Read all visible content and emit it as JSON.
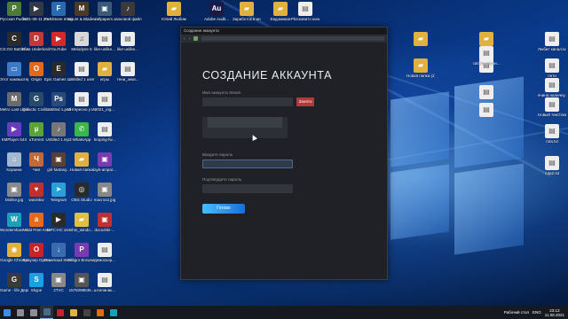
{
  "desktop": {
    "col1": [
      {
        "label": "Русская Рыбалка 4",
        "color": "#4d7a3a",
        "glyph": "Р"
      },
      {
        "label": "CS:GO Battlefield 1",
        "color": "#2b2b2b",
        "glyph": "C"
      },
      {
        "label": "Этот компьютер",
        "color": "#3c79c7",
        "glyph": "▭"
      },
      {
        "label": "Metro Last Light Redux",
        "color": "#6b6b6b",
        "glyph": "M"
      },
      {
        "label": "KMPlayer 64X",
        "color": "#6a3bbd",
        "glyph": "▶"
      },
      {
        "label": "Корзина",
        "color": "#a0b8d0",
        "glyph": "⌂"
      },
      {
        "label": "Dislike.jpg",
        "color": "#8a8a8a",
        "glyph": "▣"
      },
      {
        "label": "Wondershare Filmora X.exe",
        "color": "#1e9fb8",
        "glyph": "W"
      },
      {
        "label": "Google Chrome",
        "color": "#e0b03a",
        "glyph": "◉"
      },
      {
        "label": "Game - life Дерипал1...",
        "color": "#3a3a3a",
        "glyph": "G"
      }
    ],
    "col2": [
      {
        "label": "2021-08-11 20-13-52.mkv",
        "color": "#333a45",
        "glyph": "▶"
      },
      {
        "label": "Dota Underlords",
        "color": "#c23838",
        "glyph": "D"
      },
      {
        "label": "Origin",
        "color": "#e06a1c",
        "glyph": "O"
      },
      {
        "label": "Galactic Civilizatio...",
        "color": "#2a4a6a",
        "glyph": "G"
      },
      {
        "label": "uTorrent",
        "color": "#5aa33a",
        "glyph": "µ"
      },
      {
        "label": "Чая",
        "color": "#c06a3a",
        "glyph": "Ч"
      },
      {
        "label": "wavinkw",
        "color": "#c03030",
        "glyph": "♥"
      },
      {
        "label": "Avast Free Antivirus",
        "color": "#e66a1a",
        "glyph": "a"
      },
      {
        "label": "Браузер Opera",
        "color": "#c8222c",
        "glyph": "O"
      },
      {
        "label": "Skype",
        "color": "#1a9fe0",
        "glyph": "S"
      }
    ],
    "col3": [
      {
        "label": "FastStone Image Viewer",
        "color": "#2c6ab0",
        "glyph": "F"
      },
      {
        "label": "YouTube",
        "color": "#d02a2a",
        "glyph": "▶"
      },
      {
        "label": "Epic Games Launcher",
        "color": "#2a2a2a",
        "glyph": "E"
      },
      {
        "label": "Untitled 1.psd",
        "color": "#2a4a7a",
        "glyph": "Ps"
      },
      {
        "label": "Untitled 1.mp3",
        "color": "#777",
        "glyph": "♪"
      },
      {
        "label": "gril-fantasy...",
        "color": "#5a4030",
        "glyph": "▣"
      },
      {
        "label": "Telegram",
        "color": "#2aa0d8",
        "glyph": "➤"
      },
      {
        "label": "MPC-HC x64",
        "color": "#2a2a2a",
        "glyph": "▶"
      },
      {
        "label": "Download Studio",
        "color": "#3a6ab0",
        "glyph": "↓"
      },
      {
        "label": "2TVC",
        "color": "#888",
        "glyph": "▣"
      }
    ],
    "col4": [
      {
        "label": "Mount & Blade II...",
        "color": "#4a3a2a",
        "glyph": "M"
      },
      {
        "label": "Melodyne 5",
        "color": "#d8d8d8",
        "glyph": "♫"
      },
      {
        "label": "Untitled 1 user",
        "color": "#eeeeee",
        "glyph": "▤"
      },
      {
        "label": "Интересно у Интернете",
        "color": "#eeeeee",
        "glyph": "▤"
      },
      {
        "label": "WhatsApp",
        "color": "#3ab64a",
        "glyph": "✆"
      },
      {
        "label": "Новая папка",
        "color": "#e0b040",
        "glyph": "▰"
      },
      {
        "label": "OBS Studio",
        "color": "#2a2a2a",
        "glyph": "◎"
      },
      {
        "label": "nhm_windo...",
        "color": "#e0c040",
        "glyph": "▰"
      },
      {
        "label": "Peligro Browser",
        "color": "#7a3ab0",
        "glyph": "P"
      },
      {
        "label": "1578298636...",
        "color": "#555",
        "glyph": "▣"
      }
    ],
    "col5": [
      {
        "label": "wallpapers...",
        "color": "#3a5a7a",
        "glyph": "▣"
      },
      {
        "label": "like-unlike...",
        "color": "#eeeeee",
        "glyph": "▤"
      },
      {
        "label": "игры",
        "color": "#e0b040",
        "glyph": "▰"
      },
      {
        "label": "2021_ing...",
        "color": "#eeeeee",
        "glyph": "▤"
      },
      {
        "label": "kroping-fw...",
        "color": "#eeeeee",
        "glyph": "▤"
      },
      {
        "label": "layk-ampar...",
        "color": "#7a3ab0",
        "glyph": "▣"
      },
      {
        "label": "macros2.jpg",
        "color": "#888",
        "glyph": "▣"
      },
      {
        "label": "docushki-...",
        "color": "#c03030",
        "glyph": "▣"
      },
      {
        "label": "демоскор...",
        "color": "#eeeeee",
        "glyph": "▤"
      },
      {
        "label": "штиланак...",
        "color": "#eeeeee",
        "glyph": "▤"
      }
    ],
    "col6": [
      {
        "label": "звоковой файл",
        "color": "#3a3a3a",
        "glyph": "♪"
      },
      {
        "label": "like-unlike...",
        "color": "#eeeeee",
        "glyph": "▤"
      },
      {
        "label": "тени_зеки...",
        "color": "#eeeeee",
        "glyph": "▤"
      }
    ],
    "top_row": [
      {
        "label": "Юлий Любим",
        "color": "#e0b040",
        "glyph": "▰"
      },
      {
        "label": "Adobe Audit...",
        "color": "#1a1a4a",
        "glyph": "Au"
      },
      {
        "label": "Заработок в интернете",
        "color": "#e0b040",
        "glyph": "▰"
      },
      {
        "label": "Евдокимов",
        "color": "#e0b040",
        "glyph": "▰"
      },
      {
        "label": "Ploсковито концепт",
        "color": "#eeeeee",
        "glyph": "▤"
      }
    ],
    "right_cols": [
      {
        "label": "",
        "color": "#e0b040",
        "glyph": "▰"
      },
      {
        "label": "Новая папка (2)",
        "color": "#e0b040",
        "glyph": "▰"
      },
      {
        "label": "",
        "color": "#e0b040",
        "glyph": "▰"
      },
      {
        "label": "",
        "color": "#eeeeee",
        "glyph": "▤"
      },
      {
        "label": "",
        "color": "#eeeeee",
        "glyph": "▤"
      },
      {
        "label": "пнти",
        "color": "#eeeeee",
        "glyph": "▤"
      },
      {
        "label": "",
        "color": "#eeeeee",
        "glyph": "▤"
      },
      {
        "label": "catifon кажни...",
        "color": "#eeeeee",
        "glyph": "▤"
      },
      {
        "label": "",
        "color": "#eeeeee",
        "glyph": "▤"
      },
      {
        "label": "Любит канал.txt",
        "color": "#eeeeee",
        "glyph": "▤"
      },
      {
        "label": "ячина наличну...",
        "color": "#eeeeee",
        "glyph": "▤"
      },
      {
        "label": "Новый текстовый...",
        "color": "#eeeeee",
        "glyph": "▤"
      },
      {
        "label": "ruta.txt",
        "color": "#eeeeee",
        "glyph": "▤"
      },
      {
        "label": "ruta2.txt",
        "color": "#eeeeee",
        "glyph": "▤"
      }
    ]
  },
  "window": {
    "title": "Создание аккаунта",
    "heading": "СОЗДАНИЕ АККАУНТА",
    "steam_label": "Имя аккаунта Steam",
    "check_button": "Занято",
    "password_label": "Введите пароль",
    "confirm_label": "Подтвердите пароль",
    "submit_button": "Готово"
  },
  "taskbar": {
    "items": [
      {
        "name": "start",
        "color": "#3a8ee6"
      },
      {
        "name": "search",
        "color": "#8a8f96"
      },
      {
        "name": "task-view",
        "color": "#8a8f96"
      },
      {
        "name": "steam",
        "color": "#4a6a8a",
        "active": true
      },
      {
        "name": "opera",
        "color": "#c8222c"
      },
      {
        "name": "explorer",
        "color": "#e0b040"
      },
      {
        "name": "obs",
        "color": "#444"
      },
      {
        "name": "media",
        "color": "#e06a1c"
      },
      {
        "name": "filmora",
        "color": "#1e9fb8"
      }
    ],
    "tray_text": "Рабочий стол",
    "lang": "ENG",
    "time": "23:13",
    "date": "11.08.2021"
  }
}
